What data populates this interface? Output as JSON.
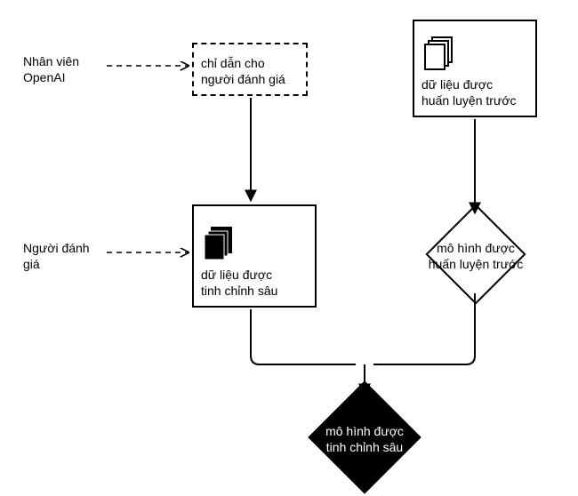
{
  "labels": {
    "staff": "Nhân viên\nOpenAI",
    "evaluator": "Người đánh\ngiá"
  },
  "nodes": {
    "instructions": "chỉ dẫn cho\nngười đánh giá",
    "pretrain_data": "dữ liệu được\nhuấn luyện trước",
    "finetune_data": "dữ liệu được\ntinh chỉnh sâu",
    "pretrain_model": "mô hình được\nhuấn luyện trước",
    "finetune_model": "mô hình được\ntinh chỉnh sâu"
  }
}
